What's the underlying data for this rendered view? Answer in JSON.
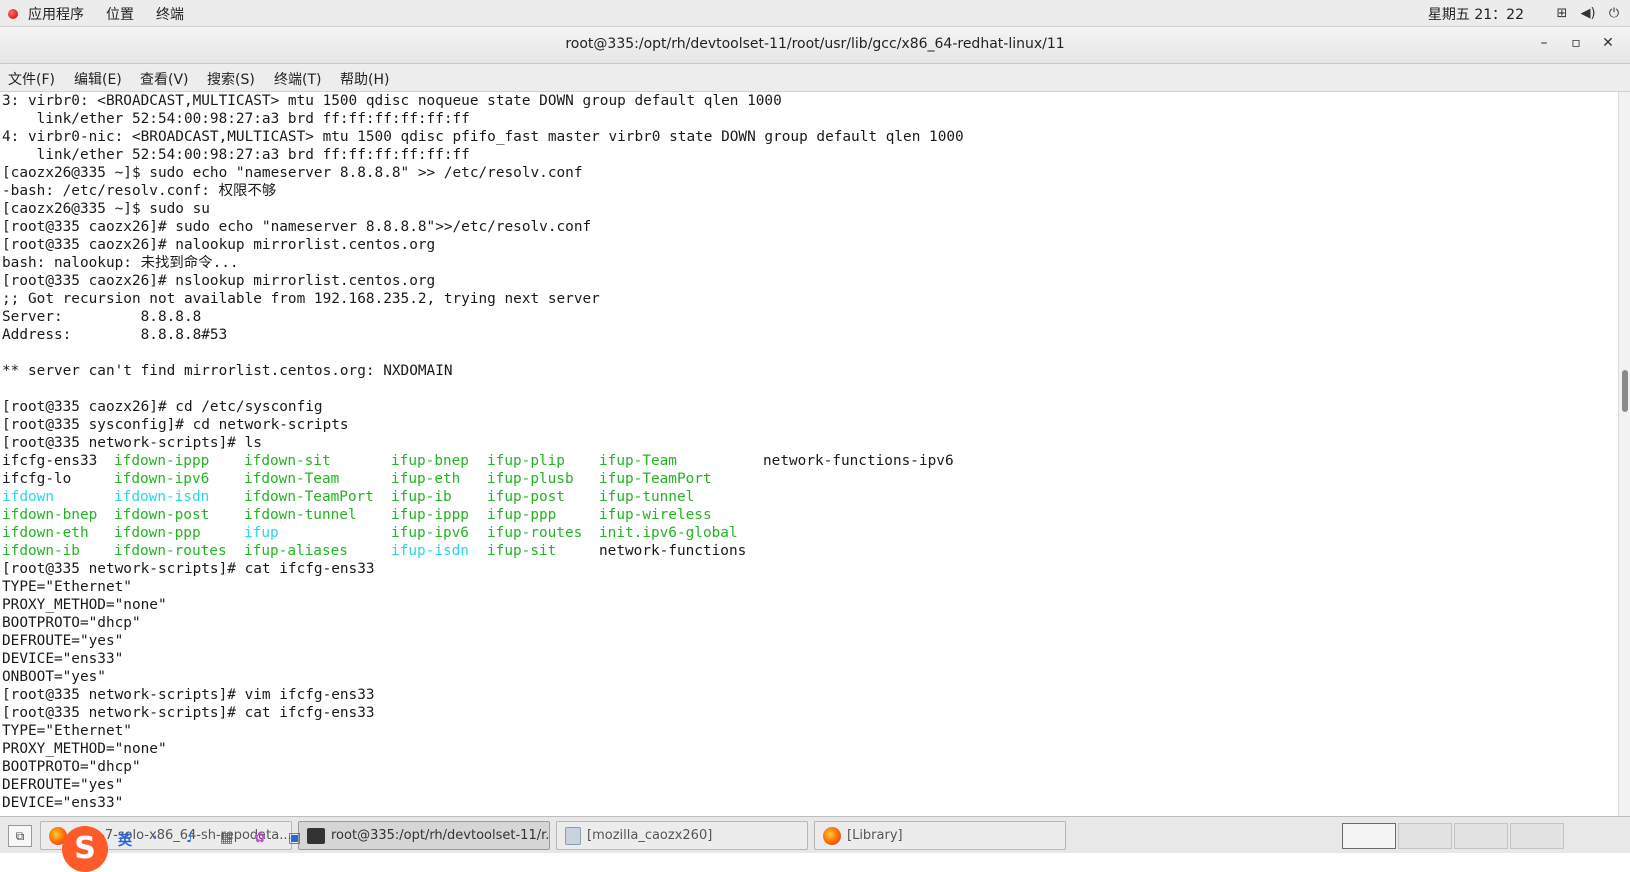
{
  "topbar": {
    "menu": [
      "应用程序",
      "位置",
      "终端"
    ],
    "clock": "星期五 21：22"
  },
  "window": {
    "title": "root@335:/opt/rh/devtoolset-11/root/usr/lib/gcc/x86_64-redhat-linux/11",
    "minimize": "–",
    "maximize": "▫",
    "close": "✕"
  },
  "menubar": [
    "文件(F)",
    "编辑(E)",
    "查看(V)",
    "搜索(S)",
    "终端(T)",
    "帮助(H)"
  ],
  "terminal": {
    "lines_before": [
      "3: virbr0: <BROADCAST,MULTICAST> mtu 1500 qdisc noqueue state DOWN group default qlen 1000",
      "    link/ether 52:54:00:98:27:a3 brd ff:ff:ff:ff:ff:ff",
      "4: virbr0-nic: <BROADCAST,MULTICAST> mtu 1500 qdisc pfifo_fast master virbr0 state DOWN group default qlen 1000",
      "    link/ether 52:54:00:98:27:a3 brd ff:ff:ff:ff:ff:ff",
      "[caozx26@335 ~]$ sudo echo \"nameserver 8.8.8.8\" >> /etc/resolv.conf",
      "-bash: /etc/resolv.conf: 权限不够",
      "[caozx26@335 ~]$ sudo su",
      "[root@335 caozx26]# sudo echo \"nameserver 8.8.8.8\">>/etc/resolv.conf",
      "[root@335 caozx26]# nalookup mirrorlist.centos.org",
      "bash: nalookup: 未找到命令...",
      "[root@335 caozx26]# nslookup mirrorlist.centos.org",
      ";; Got recursion not available from 192.168.235.2, trying next server",
      "Server:         8.8.8.8",
      "Address:        8.8.8.8#53",
      "",
      "** server can't find mirrorlist.centos.org: NXDOMAIN",
      "",
      "[root@335 caozx26]# cd /etc/sysconfig",
      "[root@335 sysconfig]# cd network-scripts",
      "[root@335 network-scripts]# ls"
    ],
    "ls_rows": [
      [
        [
          "ifcfg-ens33",
          "k"
        ],
        [
          "ifdown-ippp",
          "g"
        ],
        [
          "ifdown-sit",
          "g"
        ],
        [
          "ifup-bnep",
          "g"
        ],
        [
          "ifup-plip",
          "g"
        ],
        [
          "ifup-Team",
          "g"
        ],
        [
          "network-functions-ipv6",
          "k"
        ]
      ],
      [
        [
          "ifcfg-lo",
          "k"
        ],
        [
          "ifdown-ipv6",
          "g"
        ],
        [
          "ifdown-Team",
          "g"
        ],
        [
          "ifup-eth",
          "g"
        ],
        [
          "ifup-plusb",
          "g"
        ],
        [
          "ifup-TeamPort",
          "g"
        ],
        [
          "",
          ""
        ]
      ],
      [
        [
          "ifdown",
          "c"
        ],
        [
          "ifdown-isdn",
          "c"
        ],
        [
          "ifdown-TeamPort",
          "g"
        ],
        [
          "ifup-ib",
          "g"
        ],
        [
          "ifup-post",
          "g"
        ],
        [
          "ifup-tunnel",
          "g"
        ],
        [
          "",
          ""
        ]
      ],
      [
        [
          "ifdown-bnep",
          "g"
        ],
        [
          "ifdown-post",
          "g"
        ],
        [
          "ifdown-tunnel",
          "g"
        ],
        [
          "ifup-ippp",
          "g"
        ],
        [
          "ifup-ppp",
          "g"
        ],
        [
          "ifup-wireless",
          "g"
        ],
        [
          "",
          ""
        ]
      ],
      [
        [
          "ifdown-eth",
          "g"
        ],
        [
          "ifdown-ppp",
          "g"
        ],
        [
          "ifup",
          "c"
        ],
        [
          "ifup-ipv6",
          "g"
        ],
        [
          "ifup-routes",
          "g"
        ],
        [
          "init.ipv6-global",
          "g"
        ],
        [
          "",
          ""
        ]
      ],
      [
        [
          "ifdown-ib",
          "g"
        ],
        [
          "ifdown-routes",
          "g"
        ],
        [
          "ifup-aliases",
          "g"
        ],
        [
          "ifup-isdn",
          "c"
        ],
        [
          "ifup-sit",
          "g"
        ],
        [
          "network-functions",
          "k"
        ],
        [
          "",
          ""
        ]
      ]
    ],
    "lines_after": [
      "[root@335 network-scripts]# cat ifcfg-ens33",
      "TYPE=\"Ethernet\"",
      "PROXY_METHOD=\"none\"",
      "BOOTPROTO=\"dhcp\"",
      "DEFROUTE=\"yes\"",
      "DEVICE=\"ens33\"",
      "ONBOOT=\"yes\"",
      "[root@335 network-scripts]# vim ifcfg-ens33",
      "[root@335 network-scripts]# cat ifcfg-ens33",
      "TYPE=\"Ethernet\"",
      "PROXY_METHOD=\"none\"",
      "BOOTPROTO=\"dhcp\"",
      "DEFROUTE=\"yes\"",
      "DEVICE=\"ens33\""
    ]
  },
  "taskbar": {
    "tasks": [
      {
        "label": "...os-7-solo-x86_64-sh-repodata...",
        "icon": "firefox-icon"
      },
      {
        "label": "root@335:/opt/rh/devtoolset-11/r...",
        "icon": "terminal-icon"
      },
      {
        "label": "[mozilla_caozx260]",
        "icon": "file-icon"
      },
      {
        "label": "[Library]",
        "icon": "firefox-icon"
      }
    ],
    "ime_logo": "S",
    "ime_items": [
      "英",
      "·",
      "♪",
      "▦",
      "✿",
      "▣"
    ]
  }
}
